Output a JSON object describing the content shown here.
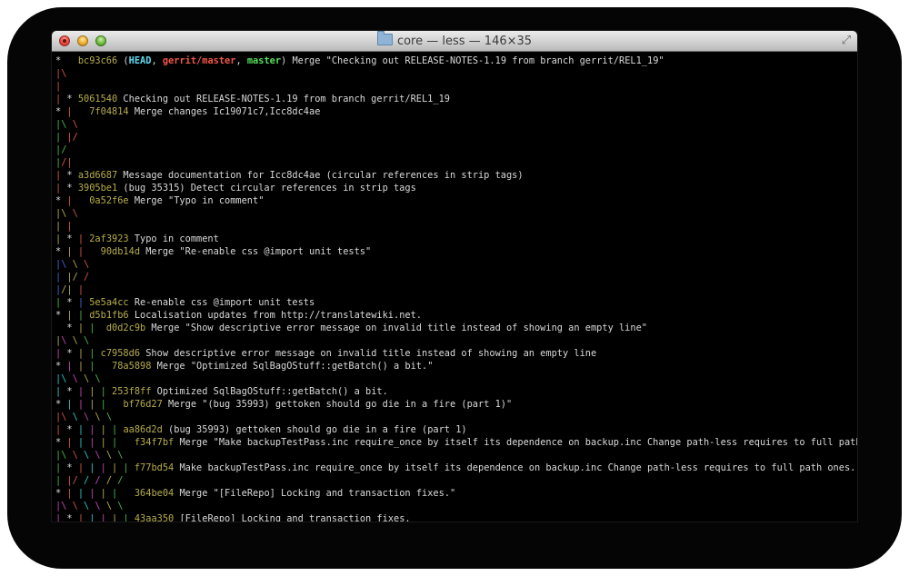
{
  "window": {
    "title": "core — less — 146×35"
  },
  "colors": {
    "red": "#d65548",
    "green": "#46bb49",
    "yellow": "#b7ac4a",
    "blue": "#3f68d8",
    "magenta": "#c645b8",
    "cyan": "#2ec6c4",
    "white": "#d9d9d9",
    "bold_cyan": "#61d9f0",
    "bold_red": "#f0564a",
    "bold_green": "#54e05a"
  },
  "lines": [
    [
      {
        "t": "*   ",
        "c": "white"
      },
      {
        "t": "bc93c66",
        "c": "yellow"
      },
      {
        "t": " (",
        "c": "white"
      },
      {
        "t": "HEAD",
        "c": "bold_cyan",
        "b": true
      },
      {
        "t": ", ",
        "c": "white"
      },
      {
        "t": "gerrit/master",
        "c": "bold_red",
        "b": true
      },
      {
        "t": ", ",
        "c": "white"
      },
      {
        "t": "master",
        "c": "bold_green",
        "b": true
      },
      {
        "t": ") Merge \"Checking out RELEASE-NOTES-1.19 from branch gerrit/REL1_19\"",
        "c": "white"
      }
    ],
    [
      {
        "t": "|",
        "c": "red"
      },
      {
        "t": "\\",
        "c": "red"
      }
    ],
    [
      {
        "t": "| ",
        "c": "red"
      }
    ],
    [
      {
        "t": "| ",
        "c": "red"
      },
      {
        "t": "* ",
        "c": "white"
      },
      {
        "t": "5061540",
        "c": "yellow"
      },
      {
        "t": " Checking out RELEASE-NOTES-1.19 from branch gerrit/REL1_19",
        "c": "white"
      }
    ],
    [
      {
        "t": "* ",
        "c": "white"
      },
      {
        "t": "|   ",
        "c": "red"
      },
      {
        "t": "7f04814",
        "c": "yellow"
      },
      {
        "t": " Merge changes Ic19071c7,Icc8dc4ae",
        "c": "white"
      }
    ],
    [
      {
        "t": "|",
        "c": "green"
      },
      {
        "t": "\\ ",
        "c": "green"
      },
      {
        "t": "\\",
        "c": "red"
      }
    ],
    [
      {
        "t": "| ",
        "c": "green"
      },
      {
        "t": "|",
        "c": "red"
      },
      {
        "t": "/",
        "c": "red"
      }
    ],
    [
      {
        "t": "|/",
        "c": "green"
      }
    ],
    [
      {
        "t": "|",
        "c": "green"
      },
      {
        "t": "/",
        "c": "red"
      },
      {
        "t": "|",
        "c": "red"
      }
    ],
    [
      {
        "t": "| ",
        "c": "red"
      },
      {
        "t": "* ",
        "c": "white"
      },
      {
        "t": "a3d6687",
        "c": "yellow"
      },
      {
        "t": " Message documentation for Icc8dc4ae (circular references in strip tags)",
        "c": "white"
      }
    ],
    [
      {
        "t": "| ",
        "c": "red"
      },
      {
        "t": "* ",
        "c": "white"
      },
      {
        "t": "3905be1",
        "c": "yellow"
      },
      {
        "t": " (bug 35315) Detect circular references in strip tags",
        "c": "white"
      }
    ],
    [
      {
        "t": "* ",
        "c": "white"
      },
      {
        "t": "|   ",
        "c": "red"
      },
      {
        "t": "0a52f6e",
        "c": "yellow"
      },
      {
        "t": " Merge \"Typo in comment\"",
        "c": "white"
      }
    ],
    [
      {
        "t": "|",
        "c": "yellow"
      },
      {
        "t": "\\ ",
        "c": "yellow"
      },
      {
        "t": "\\",
        "c": "red"
      }
    ],
    [
      {
        "t": "| ",
        "c": "yellow"
      },
      {
        "t": "|",
        "c": "red"
      }
    ],
    [
      {
        "t": "| ",
        "c": "yellow"
      },
      {
        "t": "* ",
        "c": "white"
      },
      {
        "t": "| ",
        "c": "red"
      },
      {
        "t": "2af3923",
        "c": "yellow"
      },
      {
        "t": " Typo in comment",
        "c": "white"
      }
    ],
    [
      {
        "t": "* ",
        "c": "white"
      },
      {
        "t": "| ",
        "c": "yellow"
      },
      {
        "t": "|   ",
        "c": "red"
      },
      {
        "t": "90db14d",
        "c": "yellow"
      },
      {
        "t": " Merge \"Re-enable css @import unit tests\"",
        "c": "white"
      }
    ],
    [
      {
        "t": "|",
        "c": "blue"
      },
      {
        "t": "\\ ",
        "c": "blue"
      },
      {
        "t": "\\ ",
        "c": "yellow"
      },
      {
        "t": "\\",
        "c": "red"
      }
    ],
    [
      {
        "t": "| ",
        "c": "blue"
      },
      {
        "t": "|",
        "c": "yellow"
      },
      {
        "t": "/ ",
        "c": "yellow"
      },
      {
        "t": "/",
        "c": "red"
      }
    ],
    [
      {
        "t": "|",
        "c": "blue"
      },
      {
        "t": "/",
        "c": "yellow"
      },
      {
        "t": "| ",
        "c": "yellow"
      },
      {
        "t": "|",
        "c": "red"
      }
    ],
    [
      {
        "t": "| ",
        "c": "green"
      },
      {
        "t": "* ",
        "c": "white"
      },
      {
        "t": "| ",
        "c": "blue"
      },
      {
        "t": "5e5a4cc",
        "c": "yellow"
      },
      {
        "t": " Re-enable css @import unit tests",
        "c": "white"
      }
    ],
    [
      {
        "t": "* ",
        "c": "white"
      },
      {
        "t": "| ",
        "c": "yellow"
      },
      {
        "t": "| ",
        "c": "green"
      },
      {
        "t": "d5b1fb6",
        "c": "yellow"
      },
      {
        "t": " Localisation updates from http://translatewiki.net.",
        "c": "white"
      }
    ],
    [
      {
        "t": "  ",
        "c": "white"
      },
      {
        "t": "* ",
        "c": "white"
      },
      {
        "t": "| ",
        "c": "yellow"
      },
      {
        "t": "|  ",
        "c": "green"
      },
      {
        "t": "d0d2c9b",
        "c": "yellow"
      },
      {
        "t": " Merge \"Show descriptive error message on invalid title instead of showing an empty line\"",
        "c": "white"
      }
    ],
    [
      {
        "t": "|",
        "c": "yellow"
      },
      {
        "t": "\\ ",
        "c": "magenta"
      },
      {
        "t": "\\ ",
        "c": "yellow"
      },
      {
        "t": "\\",
        "c": "green"
      }
    ],
    [
      {
        "t": "| ",
        "c": "magenta"
      },
      {
        "t": "* ",
        "c": "white"
      },
      {
        "t": "| ",
        "c": "yellow"
      },
      {
        "t": "| ",
        "c": "green"
      },
      {
        "t": "c7958d6",
        "c": "yellow"
      },
      {
        "t": " Show descriptive error message on invalid title instead of showing an empty line",
        "c": "white"
      }
    ],
    [
      {
        "t": "* ",
        "c": "white"
      },
      {
        "t": "| ",
        "c": "magenta"
      },
      {
        "t": "| ",
        "c": "yellow"
      },
      {
        "t": "|   ",
        "c": "green"
      },
      {
        "t": "78a5898",
        "c": "yellow"
      },
      {
        "t": " Merge \"Optimized SqlBagOStuff::getBatch() a bit.\"",
        "c": "white"
      }
    ],
    [
      {
        "t": "|",
        "c": "cyan"
      },
      {
        "t": "\\ ",
        "c": "cyan"
      },
      {
        "t": "\\ ",
        "c": "magenta"
      },
      {
        "t": "\\ ",
        "c": "yellow"
      },
      {
        "t": "\\",
        "c": "green"
      }
    ],
    [
      {
        "t": "| ",
        "c": "cyan"
      },
      {
        "t": "* ",
        "c": "white"
      },
      {
        "t": "| ",
        "c": "magenta"
      },
      {
        "t": "| ",
        "c": "yellow"
      },
      {
        "t": "| ",
        "c": "green"
      },
      {
        "t": "253f8ff",
        "c": "yellow"
      },
      {
        "t": " Optimized SqlBagOStuff::getBatch() a bit.",
        "c": "white"
      }
    ],
    [
      {
        "t": "* ",
        "c": "white"
      },
      {
        "t": "| ",
        "c": "cyan"
      },
      {
        "t": "| ",
        "c": "magenta"
      },
      {
        "t": "| ",
        "c": "yellow"
      },
      {
        "t": "|   ",
        "c": "green"
      },
      {
        "t": "bf76d27",
        "c": "yellow"
      },
      {
        "t": " Merge \"(bug 35993) gettoken should go die in a fire (part 1)\"",
        "c": "white"
      }
    ],
    [
      {
        "t": "|",
        "c": "red"
      },
      {
        "t": "\\ ",
        "c": "red"
      },
      {
        "t": "\\ ",
        "c": "cyan"
      },
      {
        "t": "\\ ",
        "c": "magenta"
      },
      {
        "t": "\\ ",
        "c": "yellow"
      },
      {
        "t": "\\",
        "c": "green"
      }
    ],
    [
      {
        "t": "| ",
        "c": "red"
      },
      {
        "t": "* ",
        "c": "white"
      },
      {
        "t": "| ",
        "c": "cyan"
      },
      {
        "t": "| ",
        "c": "magenta"
      },
      {
        "t": "| ",
        "c": "yellow"
      },
      {
        "t": "| ",
        "c": "green"
      },
      {
        "t": "aa86d2d",
        "c": "yellow"
      },
      {
        "t": " (bug 35993) gettoken should go die in a fire (part 1)",
        "c": "white"
      }
    ],
    [
      {
        "t": "* ",
        "c": "white"
      },
      {
        "t": "| ",
        "c": "red"
      },
      {
        "t": "| ",
        "c": "cyan"
      },
      {
        "t": "| ",
        "c": "magenta"
      },
      {
        "t": "| ",
        "c": "yellow"
      },
      {
        "t": "|   ",
        "c": "green"
      },
      {
        "t": "f34f7bf",
        "c": "yellow"
      },
      {
        "t": " Merge \"Make backupTestPass.inc require_once by itself its dependence on backup.inc Change path-less requires to full path on",
        "c": "white"
      }
    ],
    [
      {
        "t": "|",
        "c": "green"
      },
      {
        "t": "\\ ",
        "c": "green"
      },
      {
        "t": "\\ ",
        "c": "red"
      },
      {
        "t": "\\ ",
        "c": "cyan"
      },
      {
        "t": "\\ ",
        "c": "magenta"
      },
      {
        "t": "\\ ",
        "c": "yellow"
      },
      {
        "t": "\\",
        "c": "green"
      }
    ],
    [
      {
        "t": "| ",
        "c": "green"
      },
      {
        "t": "* ",
        "c": "white"
      },
      {
        "t": "| ",
        "c": "red"
      },
      {
        "t": "| ",
        "c": "cyan"
      },
      {
        "t": "| ",
        "c": "magenta"
      },
      {
        "t": "| ",
        "c": "yellow"
      },
      {
        "t": "| ",
        "c": "green"
      },
      {
        "t": "f77bd54",
        "c": "yellow"
      },
      {
        "t": " Make backupTestPass.inc require_once by itself its dependence on backup.inc Change path-less requires to full path ones.",
        "c": "white"
      }
    ],
    [
      {
        "t": "| ",
        "c": "green"
      },
      {
        "t": "|",
        "c": "red"
      },
      {
        "t": "/ ",
        "c": "red"
      },
      {
        "t": "/ ",
        "c": "cyan"
      },
      {
        "t": "/ ",
        "c": "magenta"
      },
      {
        "t": "/ ",
        "c": "yellow"
      },
      {
        "t": "/",
        "c": "green"
      }
    ],
    [
      {
        "t": "* ",
        "c": "white"
      },
      {
        "t": "| ",
        "c": "red"
      },
      {
        "t": "| ",
        "c": "cyan"
      },
      {
        "t": "| ",
        "c": "magenta"
      },
      {
        "t": "| ",
        "c": "yellow"
      },
      {
        "t": "|   ",
        "c": "green"
      },
      {
        "t": "364be04",
        "c": "yellow"
      },
      {
        "t": " Merge \"[FileRepo] Locking and transaction fixes.\"",
        "c": "white"
      }
    ],
    [
      {
        "t": "|",
        "c": "magenta"
      },
      {
        "t": "\\ ",
        "c": "magenta"
      },
      {
        "t": "\\ ",
        "c": "red"
      },
      {
        "t": "\\ ",
        "c": "cyan"
      },
      {
        "t": "\\ ",
        "c": "magenta"
      },
      {
        "t": "\\ ",
        "c": "yellow"
      },
      {
        "t": "\\",
        "c": "green"
      }
    ],
    [
      {
        "t": "| ",
        "c": "magenta"
      },
      {
        "t": "* ",
        "c": "white"
      },
      {
        "t": "| ",
        "c": "red"
      },
      {
        "t": "| ",
        "c": "cyan"
      },
      {
        "t": "| ",
        "c": "magenta"
      },
      {
        "t": "| ",
        "c": "yellow"
      },
      {
        "t": "| ",
        "c": "green"
      },
      {
        "t": "43aa350",
        "c": "yellow"
      },
      {
        "t": " [FileRepo] Locking and transaction fixes.",
        "c": "white"
      }
    ]
  ],
  "prompt": ":"
}
